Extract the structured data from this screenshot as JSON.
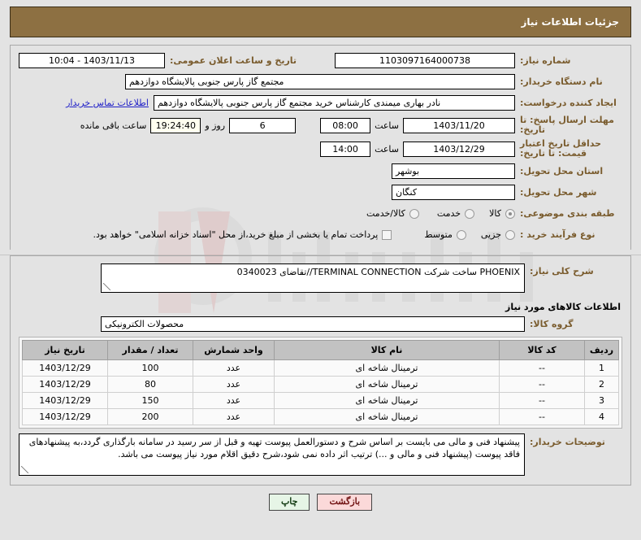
{
  "header": {
    "title": "جزئیات اطلاعات نیاز"
  },
  "fields": {
    "need_number_label": "شماره نیاز:",
    "need_number_value": "1103097164000738",
    "announce_label": "تاریخ و ساعت اعلان عمومی:",
    "announce_value": "1403/11/13 - 10:04",
    "buyer_org_label": "نام دستگاه خریدار:",
    "buyer_org_value": "مجتمع گاز پارس جنوبی  پالایشگاه دوازدهم",
    "creator_label": "ایجاد کننده درخواست:",
    "creator_value": "نادر بهاری میمندی کارشناس خرید مجتمع گاز پارس جنوبی  پالایشگاه دوازدهم",
    "contact_link": "اطلاعات تماس خریدار",
    "deadline_label": "مهلت ارسال پاسخ: تا تاریخ:",
    "deadline_date": "1403/11/20",
    "hour_label": "ساعت",
    "deadline_time": "08:00",
    "days_remaining": "6",
    "days_word": "روز و",
    "time_remaining": "19:24:40",
    "remaining_suffix": "ساعت باقی مانده",
    "price_validity_label": "حداقل تاریخ اعتبار قیمت: تا تاریخ:",
    "price_validity_date": "1403/12/29",
    "price_validity_time": "14:00",
    "province_label": "استان محل تحویل:",
    "province_value": "بوشهر",
    "city_label": "شهر محل تحویل:",
    "city_value": "کنگان",
    "category_label": "طبقه بندی موضوعی:",
    "category_options": [
      {
        "label": "کالا",
        "selected": true
      },
      {
        "label": "خدمت",
        "selected": false
      },
      {
        "label": "کالا/خدمت",
        "selected": false
      }
    ],
    "process_label": "نوع فرآیند خرید :",
    "process_options": [
      {
        "label": "جزیی",
        "selected": false
      },
      {
        "label": "متوسط",
        "selected": false
      }
    ],
    "treasury_checkbox_label": "پرداخت تمام یا بخشی از مبلغ خرید،از محل \"اسناد خزانه اسلامی\" خواهد بود.",
    "treasury_checked": false
  },
  "description": {
    "label": "شرح کلی نیاز:",
    "value": "PHOENIX ساخت شرکت TERMINAL CONNECTION//تقاضای 0340023"
  },
  "goods_section": {
    "title": "اطلاعات کالاهای مورد نیاز",
    "group_label": "گروه کالا:",
    "group_value": "محصولات الکترونیکی"
  },
  "table": {
    "columns": [
      "ردیف",
      "کد کالا",
      "نام کالا",
      "واحد شمارش",
      "تعداد / مقدار",
      "تاریخ نیاز"
    ],
    "rows": [
      {
        "row": "1",
        "code": "--",
        "name": "ترمینال شاخه ای",
        "unit": "عدد",
        "qty": "100",
        "date": "1403/12/29"
      },
      {
        "row": "2",
        "code": "--",
        "name": "ترمینال شاخه ای",
        "unit": "عدد",
        "qty": "80",
        "date": "1403/12/29"
      },
      {
        "row": "3",
        "code": "--",
        "name": "ترمینال شاخه ای",
        "unit": "عدد",
        "qty": "150",
        "date": "1403/12/29"
      },
      {
        "row": "4",
        "code": "--",
        "name": "ترمینال شاخه ای",
        "unit": "عدد",
        "qty": "200",
        "date": "1403/12/29"
      }
    ]
  },
  "buyer_notes": {
    "label": "توضیحات خریدار:",
    "value": "پیشنهاد فنی و مالی می بایست بر اساس شرح و دستورالعمل پیوست تهیه و قبل از سر رسید در سامانه بارگذاری گردد،به پیشنهادهای فاقد پیوست (پیشنهاد فنی و مالی و ...) ترتیب اثر داده نمی شود،شرح دقیق اقلام مورد نیاز پیوست می باشد."
  },
  "buttons": {
    "print": "چاپ",
    "back": "بازگشت"
  },
  "watermark": {
    "text": "iranTender.net"
  },
  "colors": {
    "header_brown": "#8d7042",
    "label_brown": "#7a5c2e",
    "link_blue": "#2020c8",
    "table_header_gray": "#c2c2c2",
    "print_button": "#e6f5e6",
    "back_button": "#fbd9d9",
    "countdown_ivory": "#ffffef"
  }
}
